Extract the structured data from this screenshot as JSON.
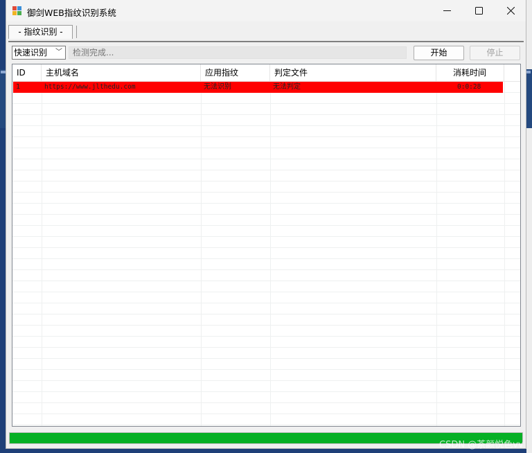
{
  "window": {
    "title": "御剑WEB指纹识别系统"
  },
  "tabs": [
    {
      "label": "- 指纹识别 -"
    }
  ],
  "toolbar": {
    "mode_selected": "快速识别",
    "status_text": "检测完成...",
    "start_label": "开始",
    "stop_label": "停止"
  },
  "table": {
    "columns": [
      "ID",
      "主机域名",
      "应用指纹",
      "判定文件",
      "消耗时间"
    ],
    "rows": [
      {
        "id": "1",
        "host": "https://www.jlthedu.com",
        "fingerprint": "无法识别",
        "file": "无法判定",
        "elapsed": "0:0:28"
      }
    ]
  },
  "progress": {
    "value_percent": 100,
    "fill_color": "#06b025"
  },
  "watermark": "CSDN @茶颜悦色vv",
  "colors": {
    "row_highlight": "#ff0000"
  }
}
